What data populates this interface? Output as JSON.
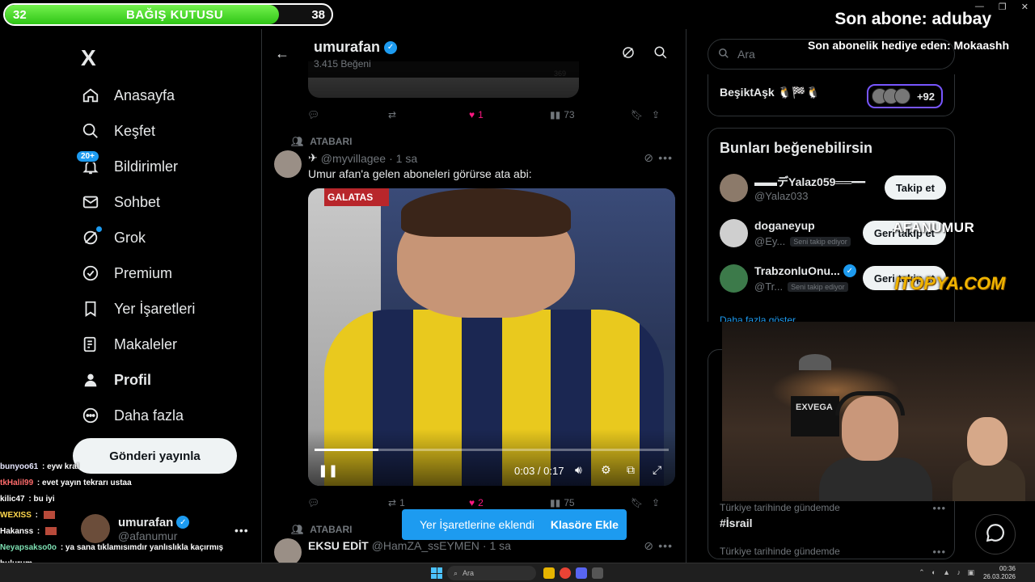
{
  "overlay": {
    "donation_title": "BAĞIŞ KUTUSU",
    "donation_current": "32",
    "donation_goal": "38",
    "donation_progress": 0.84,
    "last_sub": "Son abone: adubay",
    "last_gift": "Son abonelik hediye eden: Mokaashh",
    "watermark_1": "AFANUMUR",
    "watermark_2": "ITOPYA.COM"
  },
  "sidebar": {
    "logo": "X",
    "items": [
      {
        "label": "Anasayfa",
        "icon": "home-icon"
      },
      {
        "label": "Keşfet",
        "icon": "search-icon"
      },
      {
        "label": "Bildirimler",
        "icon": "bell-icon",
        "badge": "20+"
      },
      {
        "label": "Sohbet",
        "icon": "mail-icon"
      },
      {
        "label": "Grok",
        "icon": "grok-icon"
      },
      {
        "label": "Premium",
        "icon": "verified-icon"
      },
      {
        "label": "Yer İşaretleri",
        "icon": "bookmark-icon"
      },
      {
        "label": "Makaleler",
        "icon": "article-icon"
      },
      {
        "label": "Profil",
        "icon": "profile-icon"
      },
      {
        "label": "Daha fazla",
        "icon": "more-circle-icon"
      }
    ],
    "post_button": "Gönderi yayınla",
    "account": {
      "name": "umurafan",
      "handle": "@afanumur"
    }
  },
  "chat": [
    {
      "user": "bunyoo61",
      "text": " : eyw kral",
      "color": "#e7e7ff"
    },
    {
      "user": "tkHalil99",
      "text": " : evet yayın tekrarı ustaa",
      "color": "#ff6b6b"
    },
    {
      "user": "kilic47",
      "text": " : bu iyi",
      "color": "#ffffff"
    },
    {
      "user": "WEXISS",
      "text": " : ",
      "color": "#ffd84d"
    },
    {
      "user": "Hakanss",
      "text": " : ",
      "color": "#ffffff"
    },
    {
      "user": "Neyapsaksо0o",
      "text": " : ya sana tıklamısımdır yanlıslıkla kaçırmış",
      "color": "#7de0b3"
    },
    {
      "user": "bulurum",
      "text": "",
      "color": "#ffffff"
    }
  ],
  "profile_header": {
    "name": "umurafan",
    "likes": "3.415 Beğeni"
  },
  "prev_tweet": {
    "image_count": "369",
    "actions": {
      "reply": "",
      "retweet": "",
      "like": "1",
      "views": "73"
    }
  },
  "tweet1": {
    "context": "ATABARI",
    "handle": "@myvillagee",
    "time": "· 1 sa",
    "text": "Umur afan'a gelen aboneleri görürse ata abi:",
    "video": {
      "banner": "GALATAS",
      "time": "0:03 / 0:17",
      "progress": 0.18
    },
    "actions": {
      "reply": "",
      "retweet": "1",
      "like": "2",
      "views": "75"
    }
  },
  "tweet2": {
    "context": "ATABARI",
    "name": "EKSU EDİT",
    "handle": "@HamZA_ssEYMEN",
    "time": "· 1 sa"
  },
  "toast": {
    "message": "Yer İşaretlerine eklendi",
    "action": "Klasöre Ekle"
  },
  "right": {
    "search_placeholder": "Ara",
    "community": {
      "name": "BeşiktAşk 🐧🏁🐧",
      "count": "+92"
    },
    "who_to_follow": {
      "title": "Bunları beğenebilirsin",
      "rows": [
        {
          "name": "▬▬デYalaz059══━━",
          "handle": "@Yalaz033",
          "tag": "",
          "button": "Takip et",
          "verified": false
        },
        {
          "name": "doganeyup",
          "handle": "@Ey...",
          "tag": "Seni takip ediyor",
          "button": "Geri takip et",
          "verified": false
        },
        {
          "name": "TrabzonluOnu...",
          "handle": "@Tr...",
          "tag": "Seni takip ediyor",
          "button": "Geri takip et",
          "verified": true
        }
      ],
      "more": "Daha fazla göster"
    },
    "trends": [
      {
        "category": "Türkiye tarihinde gündemde",
        "topic": "#İsrail"
      },
      {
        "category": "Türkiye tarihinde gündemde",
        "topic": ""
      }
    ],
    "webcam_text": "EXVEGA"
  },
  "taskbar": {
    "search": "Ara",
    "time": "00:36",
    "date": "26.03.2026"
  },
  "colors": {
    "accent": "#1d9bf0",
    "like": "#f91880",
    "donation": "#4ed62a"
  }
}
